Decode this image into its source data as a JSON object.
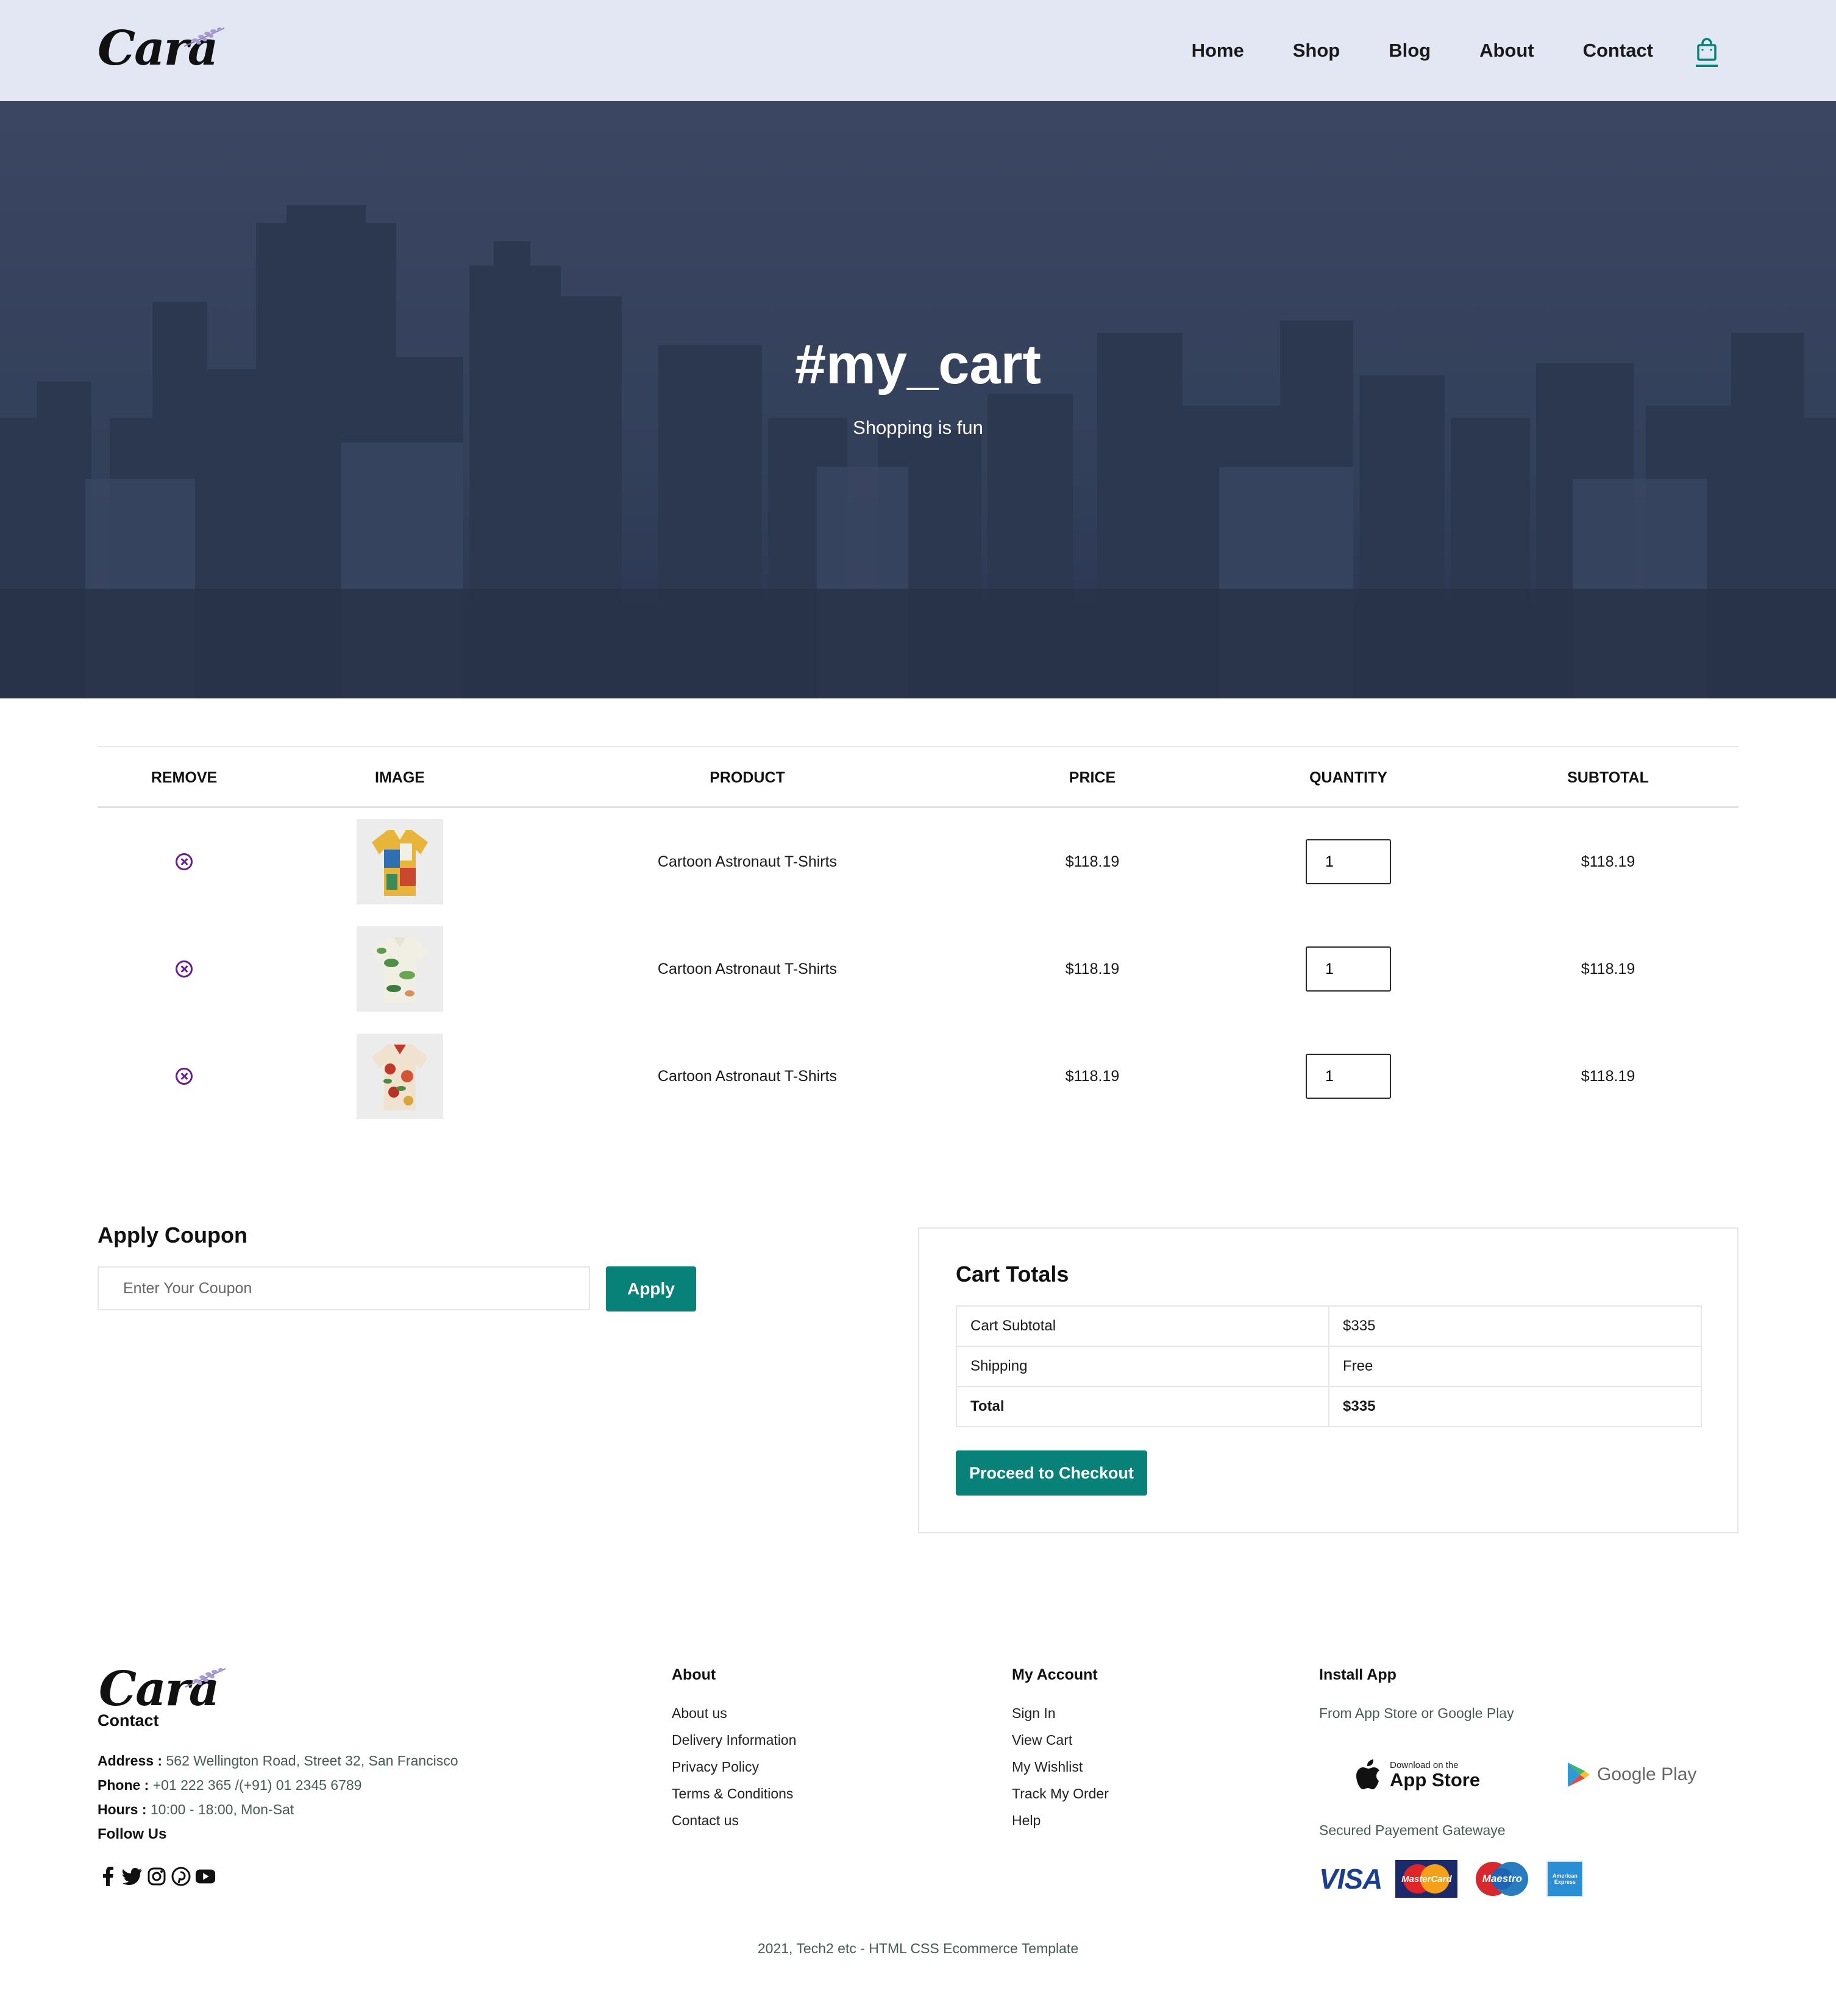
{
  "header": {
    "logo_text": "Cara",
    "nav": [
      "Home",
      "Shop",
      "Blog",
      "About",
      "Contact"
    ],
    "cart_icon": "shopping-bag-icon"
  },
  "hero": {
    "title": "#my_cart",
    "subtitle": "Shopping is fun"
  },
  "cart": {
    "columns": [
      "REMOVE",
      "IMAGE",
      "PRODUCT",
      "PRICE",
      "QUANTITY",
      "SUBTOTAL"
    ],
    "items": [
      {
        "product": "Cartoon Astronaut T-Shirts",
        "price": "$118.19",
        "quantity": "1",
        "subtotal": "$118.19"
      },
      {
        "product": "Cartoon Astronaut T-Shirts",
        "price": "$118.19",
        "quantity": "1",
        "subtotal": "$118.19"
      },
      {
        "product": "Cartoon Astronaut T-Shirts",
        "price": "$118.19",
        "quantity": "1",
        "subtotal": "$118.19"
      }
    ]
  },
  "coupon": {
    "title": "Apply Coupon",
    "placeholder": "Enter Your Coupon",
    "button": "Apply"
  },
  "totals": {
    "title": "Cart Totals",
    "rows": [
      {
        "label": "Cart Subtotal",
        "value": "$335"
      },
      {
        "label": "Shipping",
        "value": "Free"
      },
      {
        "label": "Total",
        "value": "$335"
      }
    ],
    "checkout_button": "Proceed to Checkout"
  },
  "footer": {
    "logo_text": "Cara",
    "contact_heading": "Contact",
    "address_label": "Address :",
    "address": "562 Wellington Road, Street 32, San Francisco",
    "phone_label": "Phone :",
    "phone": "+01 222 365 /(+91) 01 2345 6789",
    "hours_label": "Hours :",
    "hours": "10:00 - 18:00, Mon-Sat",
    "follow": "Follow Us",
    "about_heading": "About",
    "about_links": [
      "About us",
      "Delivery Information",
      "Privacy Policy",
      "Terms & Conditions",
      "Contact us"
    ],
    "account_heading": "My Account",
    "account_links": [
      "Sign In",
      "View Cart",
      "My Wishlist",
      "Track My Order",
      "Help"
    ],
    "install_heading": "Install App",
    "install_sub": "From App Store or Google Play",
    "app_store_small": "Download on the",
    "app_store_big": "App Store",
    "google_play": "Google Play",
    "secured": "Secured Payement Gatewaye",
    "payments": [
      "VISA",
      "MasterCard",
      "Maestro",
      "American Express"
    ],
    "copyright": "2021, Tech2 etc - HTML CSS Ecommerce Template"
  },
  "colors": {
    "accent": "#088178",
    "header_bg": "#e3e6f3",
    "remove_icon": "#6a1f8a"
  }
}
